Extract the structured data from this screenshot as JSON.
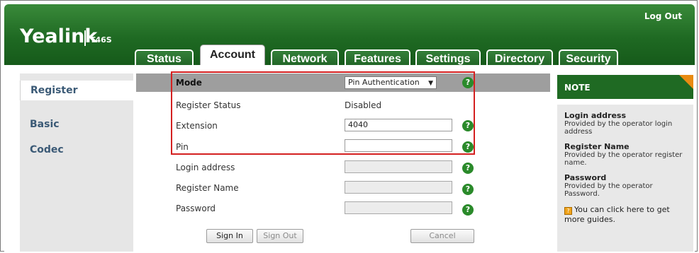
{
  "header": {
    "logo": "Yealink",
    "model": "T46S",
    "logout_label": "Log Out"
  },
  "tabs": [
    {
      "label": "Status"
    },
    {
      "label": "Account"
    },
    {
      "label": "Network"
    },
    {
      "label": "Features"
    },
    {
      "label": "Settings"
    },
    {
      "label": "Directory"
    },
    {
      "label": "Security"
    }
  ],
  "sidebar": {
    "items": [
      {
        "label": "Register"
      },
      {
        "label": "Basic"
      },
      {
        "label": "Codec"
      }
    ]
  },
  "form": {
    "mode_label": "Mode",
    "mode_value": "Pin Authentication",
    "register_status_label": "Register Status",
    "register_status_value": "Disabled",
    "extension_label": "Extension",
    "extension_value": "4040",
    "pin_label": "Pin",
    "pin_value": "",
    "login_address_label": "Login address",
    "register_name_label": "Register Name",
    "password_label": "Password",
    "help_glyph": "?"
  },
  "buttons": {
    "sign_in": "Sign In",
    "sign_out": "Sign Out",
    "cancel": "Cancel"
  },
  "note": {
    "title": "NOTE",
    "entries": [
      {
        "title": "Login address",
        "desc": "Provided by the operator login address"
      },
      {
        "title": "Register Name",
        "desc": "Provided by the operator register name."
      },
      {
        "title": "Password",
        "desc": "Provided by the operator Password."
      }
    ],
    "guide_link": "You can click here to get more guides."
  },
  "colors": {
    "brand_green": "#1f6a23",
    "accent_orange": "#e98b12",
    "highlight_red": "#d42020"
  }
}
